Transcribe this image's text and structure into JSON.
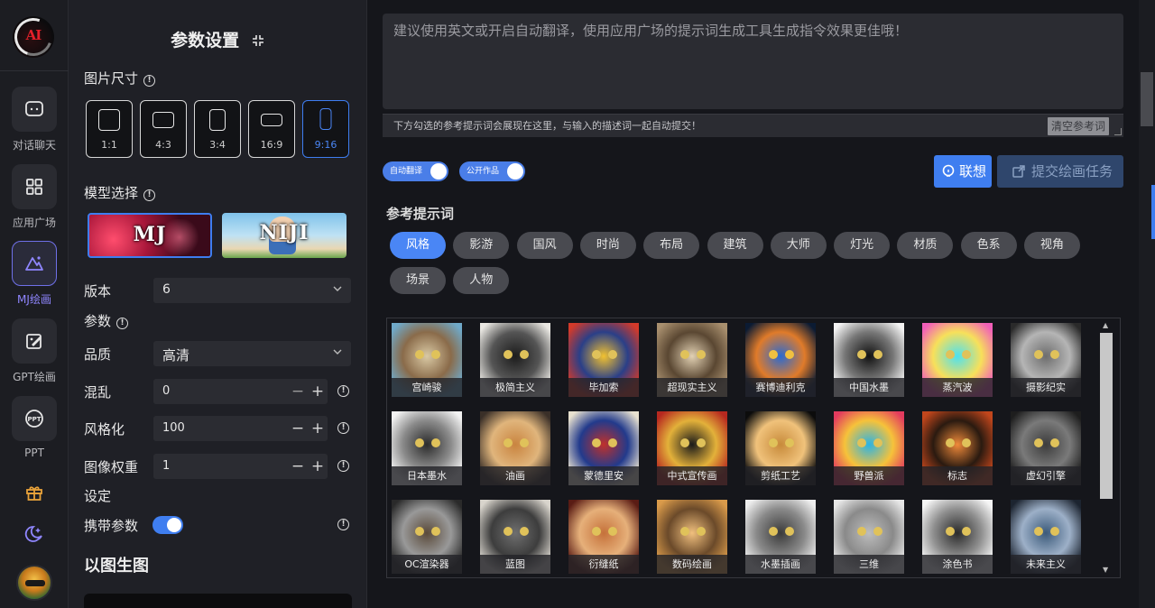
{
  "rail": {
    "logo_text": "AI",
    "items": [
      {
        "label": "对话聊天",
        "icon": "chat-icon"
      },
      {
        "label": "应用广场",
        "icon": "grid-icon"
      },
      {
        "label": "MJ绘画",
        "icon": "image-icon",
        "active": true
      },
      {
        "label": "GPT绘画",
        "icon": "draw-icon"
      },
      {
        "label": "PPT",
        "icon": "ppt-icon"
      }
    ],
    "extra_icons": [
      "gift-icon",
      "moon-icon"
    ]
  },
  "panel": {
    "title": "参数设置",
    "image_size_label": "图片尺寸",
    "ratios": [
      {
        "label": "1:1"
      },
      {
        "label": "4:3"
      },
      {
        "label": "3:4"
      },
      {
        "label": "16:9"
      },
      {
        "label": "9:16",
        "selected": true
      }
    ],
    "model_label": "模型选择",
    "models": [
      {
        "name": "MJ",
        "selected": true
      },
      {
        "name": "NIJI"
      }
    ],
    "version_label": "版本",
    "version_value": "6",
    "params_label": "参数",
    "quality_label": "品质",
    "quality_value": "高清",
    "chaos_label": "混乱",
    "chaos_value": "0",
    "stylize_label": "风格化",
    "stylize_value": "100",
    "image_weight_label": "图像权重",
    "image_weight_value": "1",
    "settings_label": "设定",
    "carry_params_label": "携带参数",
    "carry_params_on": true,
    "img2img_title": "以图生图"
  },
  "main": {
    "prompt_placeholder": "建议使用英文或开启自动翻译，使用应用广场的提示词生成工具生成指令效果更佳哦！",
    "hint_text": "下方勾选的参考提示词会展现在这里，与输入的描述词一起自动提交！",
    "clear_button": "清空参考词",
    "auto_translate_label": "自动翻译",
    "auto_translate_on": true,
    "public_label": "公开作品",
    "public_on": true,
    "associate_button": "联想",
    "submit_button": "提交绘画任务",
    "reference_title": "参考提示词",
    "tags": [
      "风格",
      "影游",
      "国风",
      "时尚",
      "布局",
      "建筑",
      "大师",
      "灯光",
      "材质",
      "色系",
      "视角",
      "场景",
      "人物"
    ],
    "active_tag": "风格",
    "styles": [
      "宫崎骏",
      "极简主义",
      "毕加索",
      "超现实主义",
      "赛博迪利克",
      "中国水墨",
      "蒸汽波",
      "摄影纪实",
      "日本墨水",
      "油画",
      "蒙德里安",
      "中式宣传画",
      "剪纸工艺",
      "野兽派",
      "标志",
      "虚幻引擎",
      "OC渲染器",
      "蓝图",
      "衍缝纸",
      "数码绘画",
      "水墨插画",
      "三维",
      "涂色书",
      "未来主义"
    ]
  }
}
